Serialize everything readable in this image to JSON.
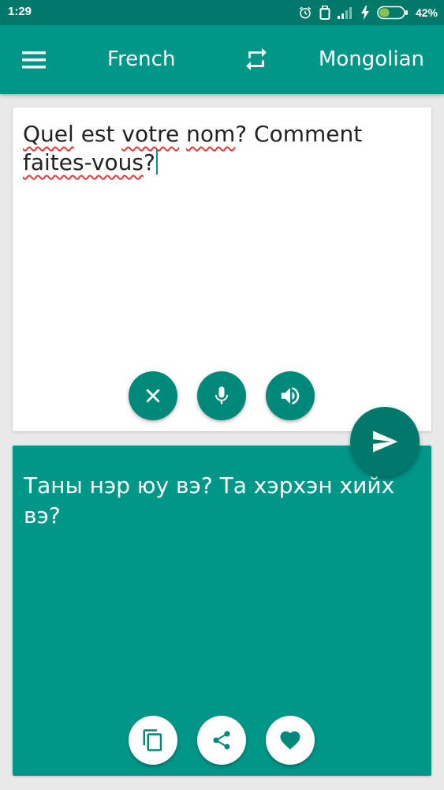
{
  "status_bar": {
    "time": "1:29",
    "battery_percent": "42%",
    "battery_level": 0.42,
    "icons": [
      "alarm-icon",
      "sim-icon",
      "signal-icon",
      "charging-icon",
      "battery-icon"
    ]
  },
  "app_bar": {
    "menu_icon": "menu-icon",
    "source_language": "French",
    "swap_icon": "swap-icon",
    "target_language": "Mongolian"
  },
  "input_card": {
    "words": [
      "Quel",
      " est ",
      "votre",
      " ",
      "nom",
      "? Comment ",
      "faites-vous",
      "?"
    ],
    "buttons": [
      "clear-icon",
      "mic-icon",
      "speaker-icon"
    ]
  },
  "send_button": {
    "icon": "send-icon"
  },
  "output_card": {
    "text": "Таны нэр юу вэ? Та хэрхэн хийх вэ?",
    "buttons": [
      "copy-icon",
      "share-icon",
      "favorite-icon"
    ]
  },
  "colors": {
    "primary": "#009688",
    "primary_dark": "#00796b",
    "spellcheck": "#e53935",
    "background": "#e9e9e9"
  }
}
